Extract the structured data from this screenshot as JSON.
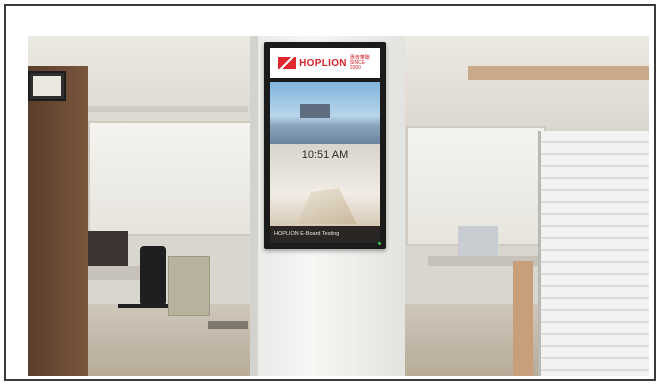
{
  "signage": {
    "brand": "HOPLION",
    "brand_sub": "惠普華聯 SINCE 2000",
    "time": "10:51 AM",
    "footer": "HOPLION E-Board Testing"
  },
  "colors": {
    "brand_red": "#d62228",
    "screen_bezel": "#1b1b1b",
    "pillar": "#f2f2f0"
  }
}
